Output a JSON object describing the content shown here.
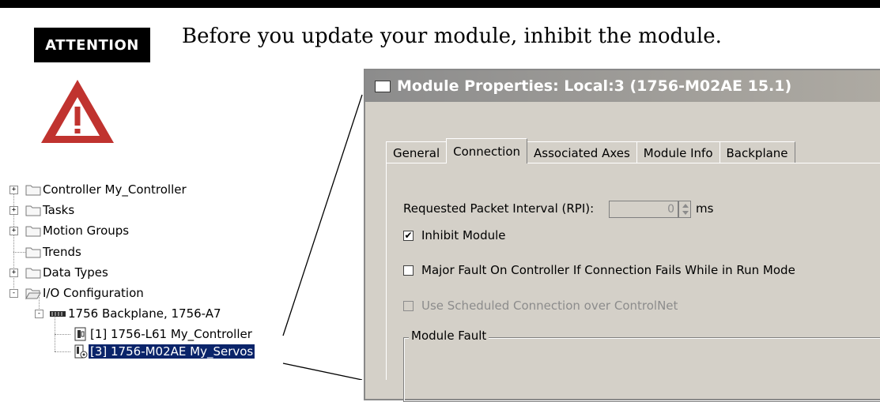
{
  "attention": {
    "badge": "ATTENTION",
    "message": "Before you update your module, inhibit the module."
  },
  "colors": {
    "warning": "#c0332f",
    "selection": "#0a246a"
  },
  "tree": {
    "items": [
      {
        "label": "Controller My_Controller",
        "icon": "folder-icon",
        "expander": "+"
      },
      {
        "label": "Tasks",
        "icon": "folder-icon",
        "expander": "+"
      },
      {
        "label": "Motion Groups",
        "icon": "folder-icon",
        "expander": "+"
      },
      {
        "label": "Trends",
        "icon": "folder-icon",
        "expander": ""
      },
      {
        "label": "Data Types",
        "icon": "folder-icon",
        "expander": "+"
      },
      {
        "label": "I/O Configuration",
        "icon": "open-folder-icon",
        "expander": "-"
      },
      {
        "label": "1756 Backplane, 1756-A7",
        "icon": "backplane-icon",
        "expander": "-"
      },
      {
        "label": "[1] 1756-L61 My_Controller",
        "icon": "controller-module-icon",
        "expander": ""
      },
      {
        "label": "[3] 1756-M02AE My_Servos",
        "icon": "servo-module-icon",
        "expander": "",
        "selected": true
      }
    ]
  },
  "dialog": {
    "title": "Module Properties: Local:3 (1756-M02AE 15.1)",
    "tabs": [
      "General",
      "Connection",
      "Associated Axes",
      "Module Info",
      "Backplane"
    ],
    "active_tab": "Connection",
    "rpi_label": "Requested Packet Interval (RPI):",
    "rpi_value": "0",
    "rpi_unit": "ms",
    "inhibit_label": "Inhibit Module",
    "inhibit_checked": true,
    "major_fault_label": "Major Fault On Controller If Connection Fails While in Run Mode",
    "major_fault_checked": false,
    "scheduled_label": "Use Scheduled Connection over ControlNet",
    "scheduled_checked": false,
    "module_fault_group": "Module Fault"
  }
}
